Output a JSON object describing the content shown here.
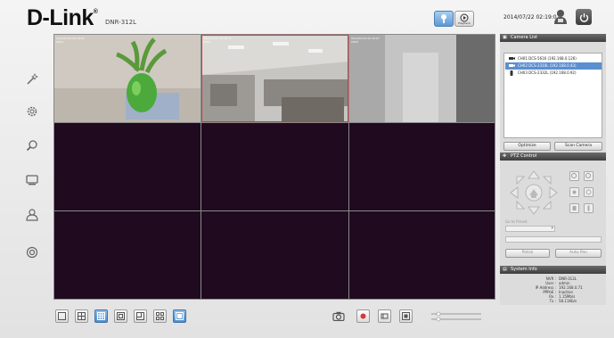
{
  "header": {
    "logo": "D-Link",
    "model": "DNR-312L",
    "playback_label": "Playback",
    "datetime": "2014/07/22 02:19:07"
  },
  "sidebar": {
    "items": [
      "wizard",
      "settings",
      "search",
      "display",
      "user",
      "status"
    ]
  },
  "grid": {
    "cells": [
      {
        "osd": [
          "2014/07/22 02:19:07",
          "CH01"
        ],
        "content": "plant"
      },
      {
        "osd": [
          "2014/07/22 02:19:07",
          "CH02"
        ],
        "content": "office",
        "selected": true
      },
      {
        "osd": [
          "2014/07/22 02:19:07",
          "CH03"
        ],
        "content": "room"
      },
      {},
      {},
      {},
      {},
      {},
      {}
    ]
  },
  "camera_list": {
    "title": "Camera List",
    "cameras": [
      {
        "label": "CH01  DCS-5616  (192.168.0.126)"
      },
      {
        "label": "CH02  DCS-2310L (192.168.0.43)",
        "selected": true
      },
      {
        "label": "CH03  DCS-2332L (192.168.0.92)"
      }
    ],
    "optimize_label": "Optimize",
    "scan_label": "Scan Camera"
  },
  "ptz": {
    "title": "PTZ Control",
    "preset_label": "Go to Preset",
    "patrol_label": "Patrol",
    "auto_pan_label": "Auto Pan"
  },
  "system_info": {
    "title": "System Info",
    "rows": [
      {
        "k": "NVR :",
        "v": "DNR-312L"
      },
      {
        "k": "User :",
        "v": "admin"
      },
      {
        "k": "IP Address :",
        "v": "192.168.0.71"
      },
      {
        "k": "PPPoE :",
        "v": "Inactive"
      },
      {
        "k": "Rx :",
        "v": "1.15Mb/s"
      },
      {
        "k": "Tx :",
        "v": "58.11Kb/s"
      }
    ]
  },
  "colors": {
    "accent": "#5b8fd0",
    "selection": "#d23b3b",
    "empty_cell": "#1f0a1f"
  }
}
